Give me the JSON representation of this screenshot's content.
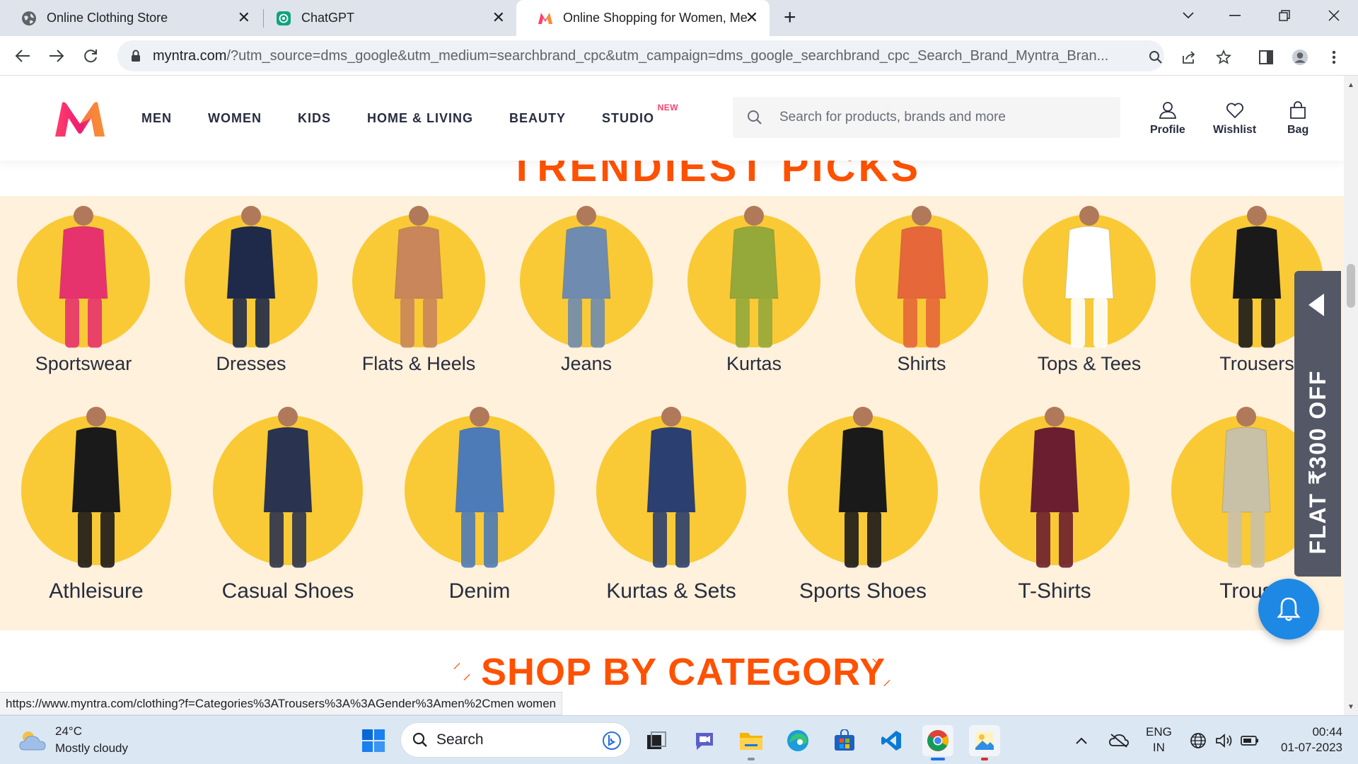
{
  "browser": {
    "tabs": [
      {
        "title": "Online Clothing Store",
        "icon": "globe-icon"
      },
      {
        "title": "ChatGPT",
        "icon": "chatgpt-icon"
      },
      {
        "title": "Online Shopping for Women, Me",
        "icon": "myntra-icon"
      }
    ],
    "url_host": "myntra.com",
    "url_rest": "/?utm_source=dms_google&utm_medium=searchbrand_cpc&utm_campaign=dms_google_searchbrand_cpc_Search_Brand_Myntra_Bran...",
    "status_url": "https://www.myntra.com/clothing?f=Categories%3ATrousers%3A%3AGender%3Amen%2Cmen women"
  },
  "header": {
    "nav": [
      "MEN",
      "WOMEN",
      "KIDS",
      "HOME & LIVING",
      "BEAUTY",
      "STUDIO"
    ],
    "new_badge": "NEW",
    "search_placeholder": "Search for products, brands and more",
    "profile_label": "Profile",
    "wishlist_label": "Wishlist",
    "bag_label": "Bag"
  },
  "section_peek": "TRENDIEST PICKS",
  "row1": [
    "Sportswear",
    "Dresses",
    "Flats & Heels",
    "Jeans",
    "Kurtas",
    "Shirts",
    "Tops & Tees",
    "Trousers"
  ],
  "row2": [
    "Athleisure",
    "Casual Shoes",
    "Denim",
    "Kurtas & Sets",
    "Sports Shoes",
    "T-Shirts",
    "Trous"
  ],
  "offer": "FLAT ₹300 OFF",
  "shop_heading": "SHOP BY CATEGORY",
  "taskbar": {
    "temperature": "24°C",
    "weather": "Mostly cloudy",
    "search_placeholder": "Search",
    "lang_top": "ENG",
    "lang_bottom": "IN",
    "time": "00:44",
    "date": "01-07-2023"
  },
  "colors": {
    "brand_pink": "#ff3f6c",
    "heading_orange": "#ff5100",
    "circle_yellow": "#f9ca36",
    "band_cream": "#fff1db",
    "offer_grey": "#535766",
    "bell_blue": "#1e88e5"
  }
}
